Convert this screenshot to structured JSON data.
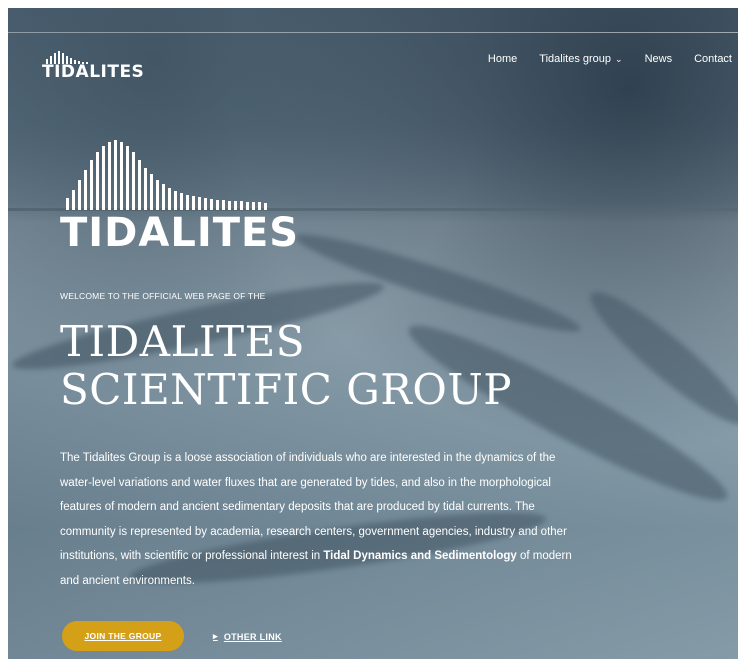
{
  "nav": {
    "logo_text": "TIDALITES",
    "items": [
      {
        "label": "Home"
      },
      {
        "label": "Tidalites group",
        "has_dropdown": true
      },
      {
        "label": "News"
      },
      {
        "label": "Contact"
      }
    ]
  },
  "hero": {
    "logo_text": "TIDALITES",
    "welcome": "WELCOME TO THE OFFICIAL WEB PAGE OF THE",
    "title_line1": "TIDALITES",
    "title_line2": "SCIENTIFIC GROUP",
    "desc_part1": "The Tidalites Group is a loose association of individuals who are interested in the dynamics of the water-level variations and water fluxes that are generated by tides, and also in the morphological features of modern and ancient sedimentary deposits that are produced by tidal currents. The community is represented by academia, research centers, government agencies, industry and other institutions, with scientific or professional interest in ",
    "desc_bold": "Tidal Dynamics and Sedimentology",
    "desc_part2": " of modern and ancient environments.",
    "cta_label": "JOIN THE GROUP",
    "link_label": "OTHER LINK"
  },
  "colors": {
    "accent": "#d4a017",
    "text": "#ffffff"
  }
}
